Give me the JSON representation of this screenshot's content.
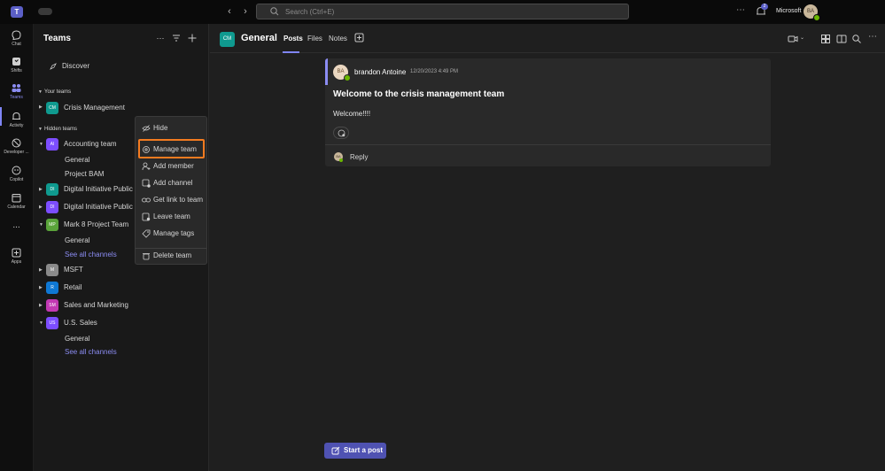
{
  "topbar": {
    "app_icon": "T",
    "pill": "",
    "search_placeholder": "Search (Ctrl+E)",
    "org_name": "Microsoft",
    "user_initials": "BA",
    "bell_badge": "2"
  },
  "rail": {
    "items": [
      {
        "label": "Chat",
        "icon": "chat-icon"
      },
      {
        "label": "Shifts",
        "icon": "shifts-icon"
      },
      {
        "label": "Teams",
        "icon": "teams-icon"
      },
      {
        "label": "Activity",
        "icon": "bell-icon"
      },
      {
        "label": "Developer ...",
        "icon": "developer-icon"
      },
      {
        "label": "Copilot",
        "icon": "copilot-icon"
      },
      {
        "label": "Calendar",
        "icon": "calendar-icon"
      },
      {
        "label": "...",
        "icon": "more-icon"
      },
      {
        "label": "Apps",
        "icon": "apps-icon"
      }
    ]
  },
  "panel": {
    "title": "Teams",
    "discover": "Discover",
    "your_teams_label": "Your teams",
    "hidden_teams_label": "Hidden teams",
    "your_teams": [
      {
        "initials": "CM",
        "name": "Crisis Management",
        "color": "#0f9a8f"
      }
    ],
    "hidden": {
      "accounting": {
        "initials": "AI",
        "name": "Accounting team",
        "color": "#7c4dff",
        "channels": [
          "General",
          "Project BAM"
        ]
      },
      "digital1": {
        "initials": "DI",
        "name": "Digital Initiative Public R",
        "color": "#0f9a8f"
      },
      "digital2": {
        "initials": "DI",
        "name": "Digital Initiative Public R",
        "color": "#7c4dff"
      },
      "mark8": {
        "initials": "MP",
        "name": "Mark 8 Project Team",
        "color": "#5aa33a",
        "channels": [
          "General"
        ],
        "see_all": "See all channels"
      },
      "msft": {
        "initials": "M",
        "name": "MSFT",
        "color": "#8a8a8a"
      },
      "retail": {
        "initials": "R",
        "name": "Retail",
        "color": "#0f78d4"
      },
      "sales": {
        "initials": "SM",
        "name": "Sales and Marketing",
        "color": "#c239b3"
      },
      "us": {
        "initials": "US",
        "name": "U.S. Sales",
        "color": "#7c4dff",
        "channels": [
          "General"
        ],
        "see_all": "See all channels"
      }
    }
  },
  "context_menu": {
    "items": [
      "Hide",
      "Manage team",
      "Add member",
      "Add channel",
      "Get link to team",
      "Leave team",
      "Manage tags",
      "Delete team"
    ]
  },
  "channel": {
    "team_initials": "CM",
    "name": "General",
    "tabs": [
      "Posts",
      "Files",
      "Notes"
    ]
  },
  "post": {
    "author_initials": "BA",
    "author": "brandon Antoine",
    "timestamp": "12/20/2023 4:49 PM",
    "subject": "Welcome to the crisis management team",
    "body": "Welcome!!!!",
    "reply_initials": "BA",
    "reply_label": "Reply"
  },
  "start_post": "Start a post",
  "colors": {
    "accent": "#7f85f5",
    "highlight": "#f47b20",
    "button": "#4f52b2"
  }
}
